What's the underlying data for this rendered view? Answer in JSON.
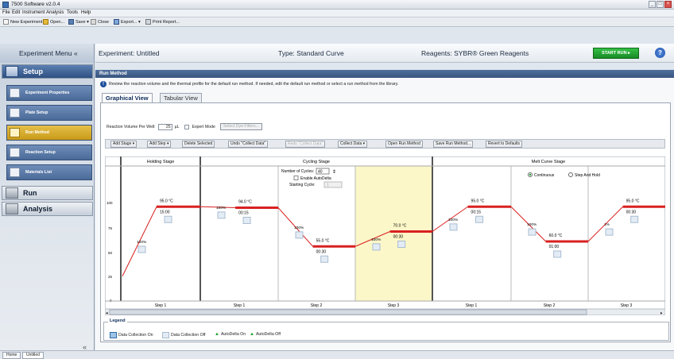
{
  "app": {
    "title": "7500 Software v2.0.4"
  },
  "menubar": [
    "File",
    "Edit",
    "Instrument",
    "Analysis",
    "Tools",
    "Help"
  ],
  "toolbar": [
    "New Experiment ▾",
    "Open...",
    "Save ▾",
    "Close",
    "Export... ▾",
    "Print Report..."
  ],
  "experiment_menu": {
    "label": "Experiment Menu «"
  },
  "header": {
    "experiment": "Experiment: Untitled",
    "type": "Type: Standard Curve",
    "reagents": "Reagents: SYBR® Green Reagents",
    "start_run": "START RUN ▸",
    "help_icon": "help-icon"
  },
  "sidebar": {
    "setup": "Setup",
    "items": [
      "Experiment Properties",
      "Plate Setup",
      "Run Method",
      "Reaction Setup",
      "Materials List"
    ],
    "run": "Run",
    "analysis": "Analysis",
    "collapse": "«"
  },
  "run_method": {
    "title": "Run Method",
    "info": "Review the reaction volume and the thermal profile for the default run method. If needed, edit the default run method or select a run method from the library.",
    "tabs": [
      "Graphical View",
      "Tabular View"
    ],
    "reaction_volume_label": "Reaction Volume Per Well:",
    "reaction_volume_value": "25",
    "reaction_volume_unit": "µL",
    "expert_mode": "Expert Mode",
    "select_filters": "Select Dye Filters...",
    "buttons": [
      "Add Stage ▾",
      "Add Step ▾",
      "Delete Selected",
      "Undo \"Collect Data\"",
      "Redo \"Collect Data\"",
      "Collect Data ▾",
      "Open Run Method",
      "Save Run Method...",
      "Revert to Defaults"
    ]
  },
  "stages": {
    "holding": "Holding Stage",
    "cycling": "Cycling Stage",
    "melt": "Melt Curve Stage",
    "cycles_label": "Number of Cycles:",
    "cycles_value": "40",
    "enable_autodelta": "Enable AutoDelta",
    "starting_cycle_label": "Starting Cycle:",
    "starting_cycle_value": "1",
    "melt_options": [
      "Continuous",
      "Step And Hold"
    ],
    "y_ticks": [
      "100",
      "75",
      "50",
      "25",
      "0"
    ]
  },
  "steps": [
    {
      "stage": "holding",
      "name": "Step 1",
      "temp": "95.0 °C",
      "time": "15:00",
      "ramp": "100%",
      "level": 95
    },
    {
      "stage": "cycling",
      "name": "Step 1",
      "temp": "94.0 °C",
      "time": "00:15",
      "ramp": "100%",
      "level": 94
    },
    {
      "stage": "cycling",
      "name": "Step 2",
      "temp": "55.0 °C",
      "time": "00:30",
      "ramp": "100%",
      "level": 55
    },
    {
      "stage": "cycling",
      "name": "Step 3",
      "temp": "70.0 °C",
      "time": "00:30",
      "ramp": "100%",
      "level": 70,
      "selected": true
    },
    {
      "stage": "melt",
      "name": "Step 1",
      "temp": "95.0 °C",
      "time": "00:15",
      "ramp": "100%",
      "level": 95
    },
    {
      "stage": "melt",
      "name": "Step 2",
      "temp": "60.0 °C",
      "time": "01:00",
      "ramp": "100%",
      "level": 60
    },
    {
      "stage": "melt",
      "name": "Step 3",
      "temp": "95.0 °C",
      "time": "00:30",
      "ramp": "1%",
      "level": 95
    }
  ],
  "legend": {
    "title": "Legend",
    "items": [
      "Data Collection On",
      "Data Collection Off",
      "AutoDelta On",
      "AutoDelta Off"
    ]
  },
  "statusbar": {
    "tabs": [
      "Home",
      "Untitled"
    ]
  },
  "colors": {
    "accent": "#2e4f82",
    "selected": "#c99a18",
    "run_green": "#1fa12e",
    "temp_line": "#d92020"
  }
}
